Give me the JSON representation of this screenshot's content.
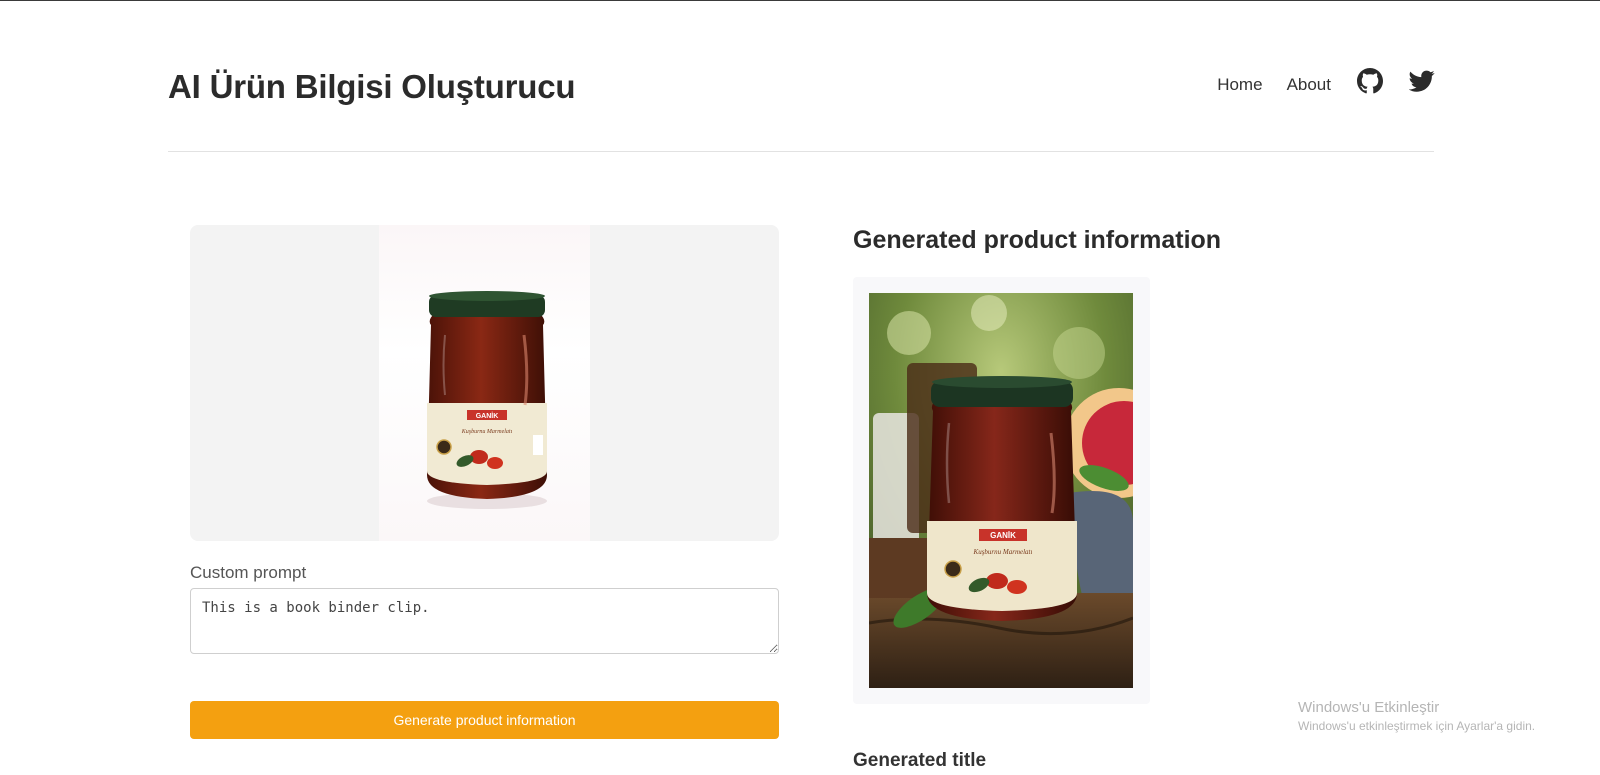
{
  "header": {
    "title": "AI Ürün Bilgisi Oluşturucu",
    "nav": {
      "home": "Home",
      "about": "About",
      "icons": [
        "github-icon",
        "twitter-icon"
      ]
    }
  },
  "left_panel": {
    "upload_image_alt": "GANİK Kuşburnu Marmelatı jar",
    "custom_prompt_label": "Custom prompt",
    "custom_prompt_value": "This is a book binder clip.",
    "generate_button_label": "Generate product information"
  },
  "right_panel": {
    "heading": "Generated product information",
    "generated_title_label": "Generated title"
  },
  "overlay": {
    "activation_title": "Windows'u Etkinleştir",
    "activation_subtitle": "Windows'u etkinleştirmek için Ayarlar'a gidin."
  },
  "colors": {
    "accent": "#f4a010",
    "text": "#2b2b2b",
    "upload_bg": "#f3f3f3"
  }
}
